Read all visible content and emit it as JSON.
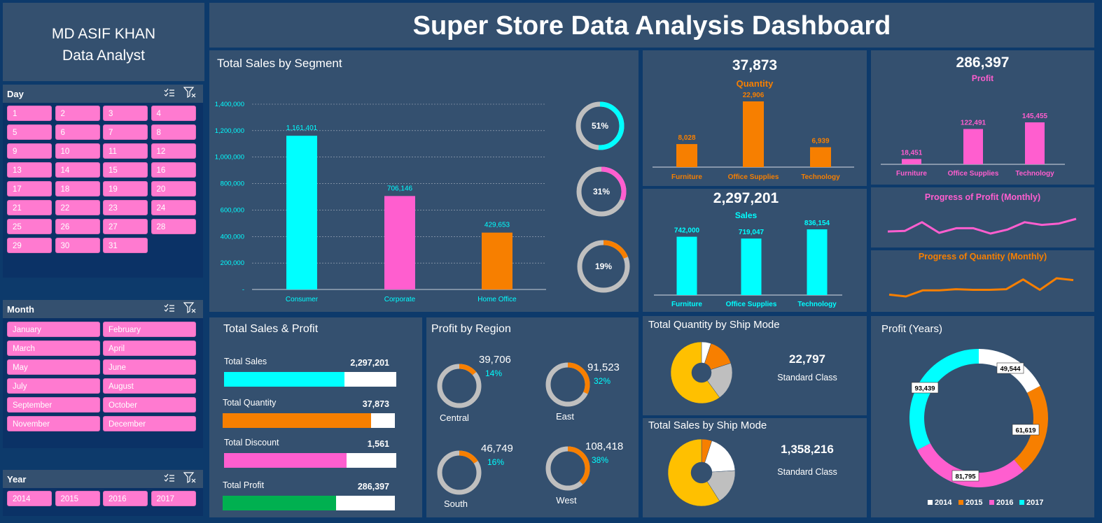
{
  "author": {
    "name": "MD ASIF KHAN",
    "role": "Data Analyst"
  },
  "dashboard_title": "Super Store Data Analysis Dashboard",
  "slicers": {
    "day": {
      "title": "Day",
      "items": [
        "1",
        "2",
        "3",
        "4",
        "5",
        "6",
        "7",
        "8",
        "9",
        "10",
        "11",
        "12",
        "13",
        "14",
        "15",
        "16",
        "17",
        "18",
        "19",
        "20",
        "21",
        "22",
        "23",
        "24",
        "25",
        "26",
        "27",
        "28",
        "29",
        "30",
        "31"
      ]
    },
    "month": {
      "title": "Month",
      "items": [
        "January",
        "February",
        "March",
        "April",
        "May",
        "June",
        "July",
        "August",
        "September",
        "October",
        "November",
        "December"
      ]
    },
    "year": {
      "title": "Year",
      "items": [
        "2014",
        "2015",
        "2016",
        "2017"
      ]
    }
  },
  "colors": {
    "cyan": "#00ffff",
    "pink": "#ff5ecf",
    "orange": "#f77f00",
    "green": "#00b050",
    "grey": "#bfbfbf",
    "gold": "#ffc000",
    "white": "#ffffff"
  },
  "segment": {
    "title": "Total Sales by Segment",
    "chart_data": {
      "type": "bar",
      "categories": [
        "Consumer",
        "Corporate",
        "Home Office"
      ],
      "values": [
        1161401,
        706146,
        429653
      ],
      "value_labels": [
        "1,161,401",
        "706,146",
        "429,653"
      ],
      "ylim": [
        0,
        1400000
      ],
      "yticks": [
        "-",
        "200,000",
        "400,000",
        "600,000",
        "800,000",
        "1,000,000",
        "1,200,000",
        "1,400,000"
      ],
      "grid": true
    },
    "donuts": [
      {
        "label": "51%",
        "value": 51,
        "color": "#00ffff"
      },
      {
        "label": "31%",
        "value": 31,
        "color": "#ff5ecf"
      },
      {
        "label": "19%",
        "value": 19,
        "color": "#f77f00"
      }
    ]
  },
  "quantity_card": {
    "value": "37,873",
    "label": "Quantity",
    "chart_data": {
      "type": "bar",
      "categories": [
        "Furniture",
        "Office Supplies",
        "Technology"
      ],
      "values": [
        8028,
        22906,
        6939
      ],
      "value_labels": [
        "8,028",
        "22,906",
        "6,939"
      ]
    }
  },
  "profit_card": {
    "value": "286,397",
    "label": "Profit",
    "chart_data": {
      "type": "bar",
      "categories": [
        "Furniture",
        "Office Supplies",
        "Technology"
      ],
      "values": [
        18451,
        122491,
        145455
      ],
      "value_labels": [
        "18,451",
        "122,491",
        "145,455"
      ]
    }
  },
  "sales_card": {
    "value": "2,297,201",
    "label": "Sales",
    "chart_data": {
      "type": "bar",
      "categories": [
        "Furniture",
        "Office Supplies",
        "Technology"
      ],
      "values": [
        742000,
        719047,
        836154
      ],
      "value_labels": [
        "742,000",
        "719,047",
        "836,154"
      ]
    }
  },
  "profit_monthly": {
    "title": "Progress of Profit (Monthly)",
    "chart_data": {
      "type": "line",
      "values": [
        8,
        9,
        22,
        6,
        13,
        13,
        5,
        11,
        22,
        18,
        20,
        27
      ]
    }
  },
  "quantity_monthly": {
    "title": "Progress of Quantity (Monthly)",
    "chart_data": {
      "type": "line",
      "values": [
        3,
        0,
        10,
        10,
        12,
        11,
        11,
        12,
        28,
        11,
        30,
        27
      ]
    }
  },
  "totals": {
    "title": "Total Sales & Profit",
    "rows": [
      {
        "label": "Total Sales",
        "value": "2,297,201",
        "fill": 0.7,
        "color": "#00ffff"
      },
      {
        "label": "Total Quantity",
        "value": "37,873",
        "fill": 0.86,
        "color": "#f77f00"
      },
      {
        "label": "Total Discount",
        "value": "1,561",
        "fill": 0.71,
        "color": "#ff5ecf"
      },
      {
        "label": "Total Profit",
        "value": "286,397",
        "fill": 0.66,
        "color": "#00b050"
      }
    ]
  },
  "region": {
    "title": "Profit by Region",
    "items": [
      {
        "name": "Central",
        "value": "39,706",
        "pct": "14%",
        "fraction": 0.14
      },
      {
        "name": "East",
        "value": "91,523",
        "pct": "32%",
        "fraction": 0.32
      },
      {
        "name": "South",
        "value": "46,749",
        "pct": "16%",
        "fraction": 0.16
      },
      {
        "name": "West",
        "value": "108,418",
        "pct": "38%",
        "fraction": 0.38
      }
    ]
  },
  "ship_quantity": {
    "title": "Total Quantity by Ship Mode",
    "value": "22,797",
    "mode": "Standard Class",
    "chart_data": {
      "type": "pie",
      "values": [
        5,
        15,
        20,
        60
      ],
      "colors": [
        "#ffffff",
        "#f77f00",
        "#bfbfbf",
        "#ffc000"
      ]
    }
  },
  "ship_sales": {
    "title": "Total Sales by Ship Mode",
    "value": "1,358,216",
    "mode": "Standard Class",
    "chart_data": {
      "type": "pie",
      "values": [
        5,
        19,
        17,
        59
      ],
      "colors": [
        "#f77f00",
        "#ffffff",
        "#bfbfbf",
        "#ffc000"
      ]
    }
  },
  "profit_years": {
    "title": "Profit (Years)",
    "chart_data": {
      "type": "pie",
      "categories": [
        "2014",
        "2015",
        "2016",
        "2017"
      ],
      "values": [
        49544,
        61619,
        81795,
        93439
      ],
      "value_labels": [
        "49,544",
        "61,619",
        "81,795",
        "93,439"
      ],
      "colors": [
        "#ffffff",
        "#f77f00",
        "#ff5ecf",
        "#00ffff"
      ],
      "legend": "bottom"
    }
  }
}
